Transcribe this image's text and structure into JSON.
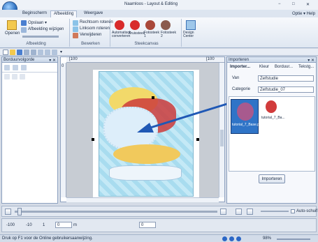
{
  "window": {
    "title": "Naamloos - Layout & Editing",
    "controls": {
      "minimize": "−",
      "maximize": "□",
      "close": "✕"
    },
    "help_options": "Optie ▾  Help"
  },
  "tabs": [
    {
      "label": "Beginscherm"
    },
    {
      "label": "Afbeelding"
    },
    {
      "label": "Weergave"
    }
  ],
  "ribbon": {
    "groups": {
      "afbeelding": {
        "label": "Afbeelding",
        "openen": "Openen",
        "opslaan": "Opslaan ▾",
        "wijzigen": "Afbeelding wijzigen"
      },
      "bewerken": {
        "label": "Bewerken",
        "rechtsom": "Rechtsom roteren",
        "linksom": "Linksom roteren",
        "verwijderen": "Verwijderen"
      },
      "steekcanvas": {
        "label": "Steekcanvas",
        "items": [
          "Automatisch converteren",
          "Kruissteek",
          "Fotosteek 1",
          "Fotosteek 2"
        ],
        "design_center": "Design Center"
      }
    }
  },
  "qat": {
    "marker": "▾"
  },
  "left_panel": {
    "title": "Borduurvolgorde",
    "pin": "▾ ✕"
  },
  "canvas": {
    "ruler_h_marks": [
      "[100",
      "",
      "",
      "",
      "",
      "",
      "",
      "",
      "",
      "",
      "",
      "",
      "",
      "",
      "",
      "[100"
    ],
    "ruler_v_marks": [
      "0",
      "",
      "",
      "",
      "",
      "",
      "",
      "",
      "",
      ""
    ]
  },
  "right_panel": {
    "title": "Importeren",
    "pin": "▾ ✕",
    "tabs": [
      "Importer...",
      "Kleur",
      "Borduur...",
      "Tekstg..."
    ],
    "van_label": "Van",
    "van_value": "Zelfstudie",
    "categorie_label": "Categorie",
    "categorie_value": "Zelfstudie_07",
    "thumbs": [
      {
        "label": "tutorial_7_Base.pes",
        "selected": true
      },
      {
        "label": "tutorial_7_Ba..."
      }
    ],
    "import_button": "Importeren"
  },
  "playbar": {
    "auto_scroll": "Auto-schuif"
  },
  "editbar": {
    "fields": [
      "-100",
      "-10",
      "1",
      "0"
    ],
    "unit": "m",
    "percent_value": "0"
  },
  "statusbar": {
    "help_text": "Druk op F1 voor de Online gebruikersaanwijzing.",
    "zoom": "98%"
  },
  "colors": {
    "accent": "#2b5fa9",
    "ribbon_bg": "#e8eef7",
    "canvas_bg": "#c7ccd3"
  }
}
